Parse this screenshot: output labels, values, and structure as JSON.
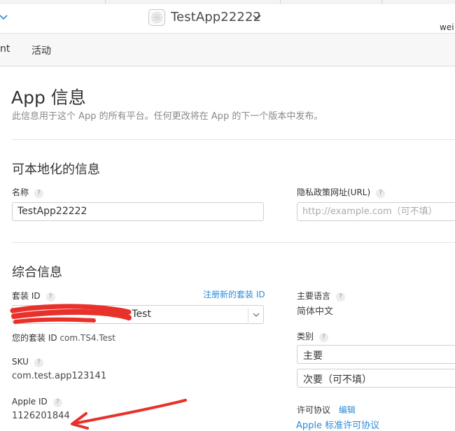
{
  "header": {
    "app_name": "TestApp22222",
    "user_name": "wei"
  },
  "tabs": [
    {
      "label": "nt"
    },
    {
      "label": "活动"
    }
  ],
  "page": {
    "title": "App 信息",
    "subtitle": "此信息用于这个 App 的所有平台。任何更改将在 App 的下一个版本中发布。"
  },
  "localizable": {
    "section_title": "可本地化的信息",
    "name_label": "名称",
    "name_value": "TestApp22222",
    "privacy_label": "隐私政策网址(URL)",
    "privacy_placeholder": "http://example.com（可不填）"
  },
  "general": {
    "section_title": "综合信息",
    "bundle_label": "套装 ID",
    "register_link": "注册新的套装 ID",
    "bundle_value_visible": "4.Test",
    "your_bundle_prefix": "您的套装 ID",
    "your_bundle_value": "com.TS4.Test",
    "sku_label": "SKU",
    "sku_value": "com.test.app123141",
    "apple_id_label": "Apple ID",
    "apple_id_value": "1126201844",
    "primary_language_label": "主要语言",
    "primary_language_value": "简体中文",
    "category_label": "类别",
    "category_primary": "主要",
    "category_secondary": "次要（可不填）",
    "license_label": "许可协议",
    "license_edit": "编辑",
    "license_value": "Apple 标准许可协议"
  },
  "help_glyph": "?",
  "colors": {
    "link": "#2d8ad6",
    "annotation_red": "#e8312a"
  }
}
